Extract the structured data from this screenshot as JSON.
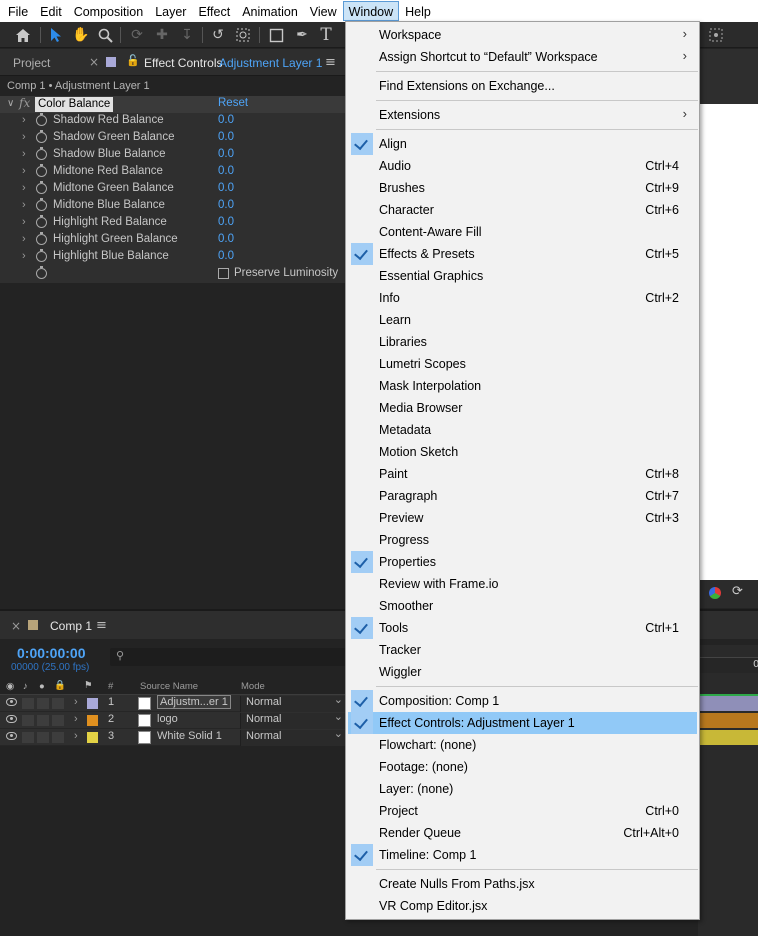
{
  "menubar": {
    "items": [
      "File",
      "Edit",
      "Composition",
      "Layer",
      "Effect",
      "Animation",
      "View",
      "Window",
      "Help"
    ],
    "active_index": 7
  },
  "effect_controls": {
    "tab_project": "Project",
    "tab_effect_controls": "Effect Controls",
    "tab_layer": "Adjustment Layer 1",
    "layer_path": "Comp 1 • Adjustment Layer 1",
    "fx_label": "fx",
    "effect_name": "Color Balance",
    "reset": "Reset",
    "params": [
      {
        "label": "Shadow Red Balance",
        "value": "0.0"
      },
      {
        "label": "Shadow Green Balance",
        "value": "0.0"
      },
      {
        "label": "Shadow Blue Balance",
        "value": "0.0"
      },
      {
        "label": "Midtone Red Balance",
        "value": "0.0"
      },
      {
        "label": "Midtone Green Balance",
        "value": "0.0"
      },
      {
        "label": "Midtone Blue Balance",
        "value": "0.0"
      },
      {
        "label": "Highlight Red Balance",
        "value": "0.0"
      },
      {
        "label": "Highlight Green Balance",
        "value": "0.0"
      },
      {
        "label": "Highlight Blue Balance",
        "value": "0.0"
      }
    ],
    "preserve_luminosity": "Preserve Luminosity"
  },
  "timeline": {
    "tab": "Comp 1",
    "timecode": "0:00:00:00",
    "fps": "00000 (25.00 fps)",
    "search_icon": "search-icon",
    "col_hash": "#",
    "col_source": "Source Name",
    "col_mode": "Mode",
    "layers": [
      {
        "num": "1",
        "name": "Adjustm...er 1",
        "mode": "Normal",
        "color": "#a9a9d8",
        "bar": "#8f8fb8"
      },
      {
        "num": "2",
        "name": "logo",
        "mode": "Normal",
        "color": "#e0901f",
        "bar": "#b8781e"
      },
      {
        "num": "3",
        "name": "White Solid 1",
        "mode": "Normal",
        "color": "#e3d245",
        "bar": "#c8b837"
      }
    ]
  },
  "window_menu": {
    "items": [
      {
        "label": "Workspace",
        "submenu": true
      },
      {
        "label": "Assign Shortcut to “Default” Workspace",
        "submenu": true
      },
      {
        "label": "Find Extensions on Exchange..."
      },
      {
        "label": "Extensions",
        "submenu": true
      },
      {
        "label": "Align",
        "checked": true
      },
      {
        "label": "Audio",
        "shortcut": "Ctrl+4"
      },
      {
        "label": "Brushes",
        "shortcut": "Ctrl+9"
      },
      {
        "label": "Character",
        "shortcut": "Ctrl+6"
      },
      {
        "label": "Content-Aware Fill"
      },
      {
        "label": "Effects & Presets",
        "shortcut": "Ctrl+5",
        "checked": true
      },
      {
        "label": "Essential Graphics"
      },
      {
        "label": "Info",
        "shortcut": "Ctrl+2"
      },
      {
        "label": "Learn"
      },
      {
        "label": "Libraries"
      },
      {
        "label": "Lumetri Scopes"
      },
      {
        "label": "Mask Interpolation"
      },
      {
        "label": "Media Browser"
      },
      {
        "label": "Metadata"
      },
      {
        "label": "Motion Sketch"
      },
      {
        "label": "Paint",
        "shortcut": "Ctrl+8"
      },
      {
        "label": "Paragraph",
        "shortcut": "Ctrl+7"
      },
      {
        "label": "Preview",
        "shortcut": "Ctrl+3"
      },
      {
        "label": "Progress"
      },
      {
        "label": "Properties",
        "checked": true
      },
      {
        "label": "Review with Frame.io"
      },
      {
        "label": "Smoother"
      },
      {
        "label": "Tools",
        "shortcut": "Ctrl+1",
        "checked": true
      },
      {
        "label": "Tracker"
      },
      {
        "label": "Wiggler"
      },
      {
        "label": "Composition: Comp 1",
        "checked": true
      },
      {
        "label": "Effect Controls: Adjustment Layer 1",
        "checked": true,
        "highlighted": true
      },
      {
        "label": "Flowchart: (none)"
      },
      {
        "label": "Footage: (none)"
      },
      {
        "label": "Layer: (none)"
      },
      {
        "label": "Project",
        "shortcut": "Ctrl+0"
      },
      {
        "label": "Render Queue",
        "shortcut": "Ctrl+Alt+0"
      },
      {
        "label": "Timeline: Comp 1",
        "checked": true
      },
      {
        "label": "Create Nulls From Paths.jsx"
      },
      {
        "label": "VR Comp Editor.jsx"
      }
    ]
  }
}
